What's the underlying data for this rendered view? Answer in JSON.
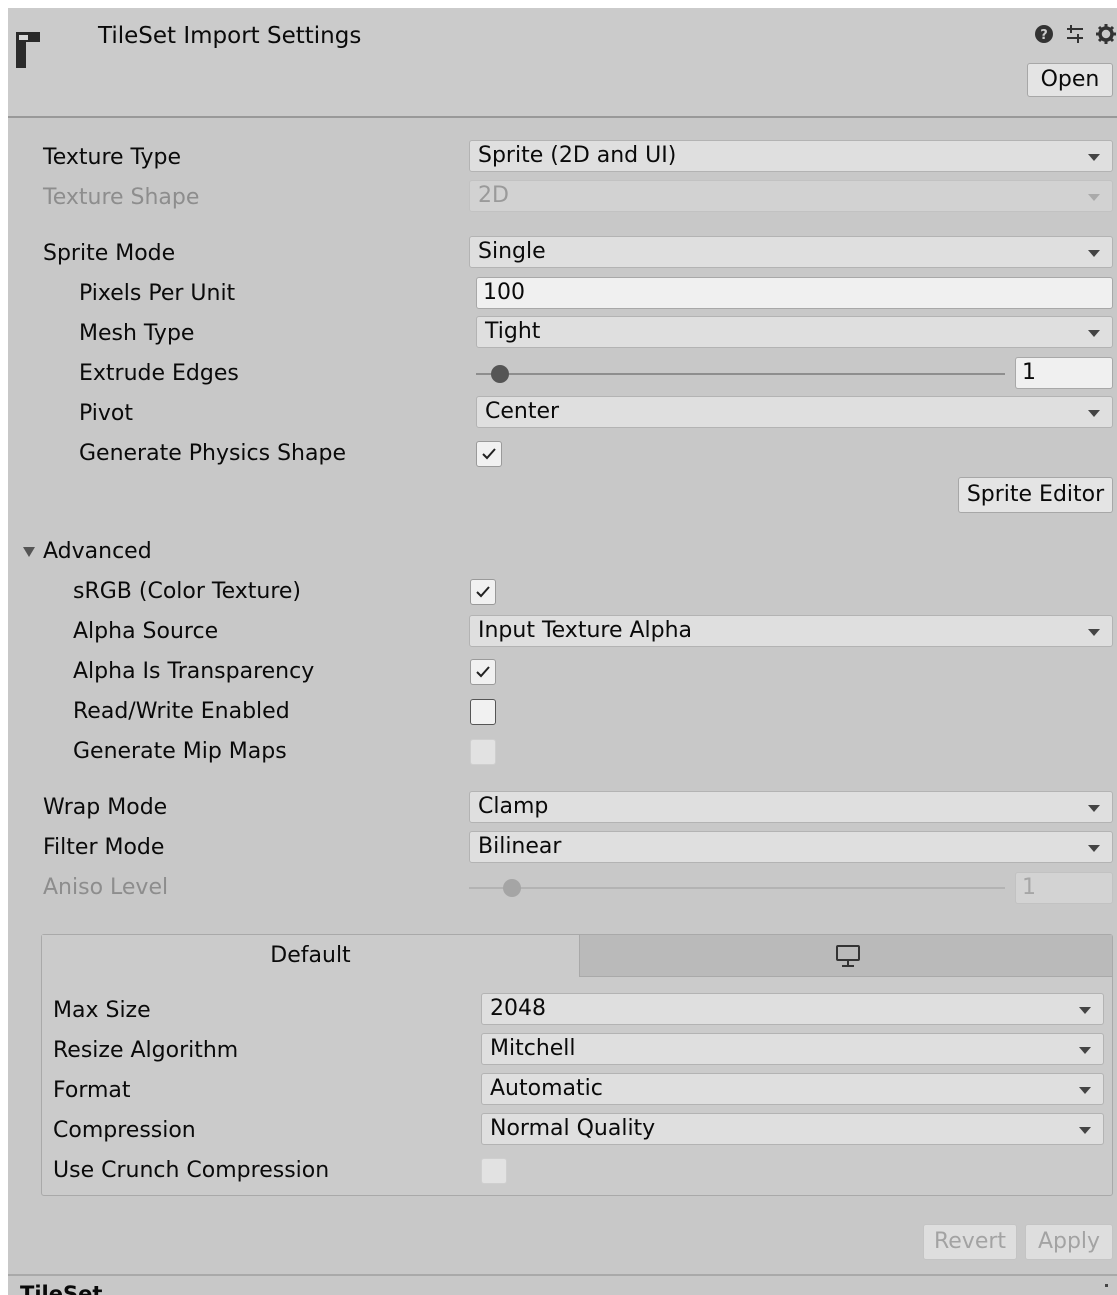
{
  "header": {
    "title": "TileSet Import Settings",
    "open_label": "Open",
    "icons": [
      "help-icon",
      "preset-icon",
      "settings-gear-icon"
    ]
  },
  "settings": {
    "texture_type": {
      "label": "Texture Type",
      "value": "Sprite (2D and UI)"
    },
    "texture_shape": {
      "label": "Texture Shape",
      "value": "2D"
    },
    "sprite_mode": {
      "label": "Sprite Mode",
      "value": "Single"
    },
    "pixels_per_unit": {
      "label": "Pixels Per Unit",
      "value": "100"
    },
    "mesh_type": {
      "label": "Mesh Type",
      "value": "Tight"
    },
    "extrude_edges": {
      "label": "Extrude Edges",
      "value": "1"
    },
    "pivot": {
      "label": "Pivot",
      "value": "Center"
    },
    "generate_physics_shape": {
      "label": "Generate Physics Shape",
      "checked": true
    },
    "sprite_editor_label": "Sprite Editor"
  },
  "advanced": {
    "title": "Advanced",
    "srgb": {
      "label": "sRGB (Color Texture)",
      "checked": true
    },
    "alpha_source": {
      "label": "Alpha Source",
      "value": "Input Texture Alpha"
    },
    "alpha_is_transparency": {
      "label": "Alpha Is Transparency",
      "checked": true
    },
    "read_write": {
      "label": "Read/Write Enabled",
      "checked": false
    },
    "generate_mip_maps": {
      "label": "Generate Mip Maps",
      "checked": false
    }
  },
  "sampling": {
    "wrap_mode": {
      "label": "Wrap Mode",
      "value": "Clamp"
    },
    "filter_mode": {
      "label": "Filter Mode",
      "value": "Bilinear"
    },
    "aniso_level": {
      "label": "Aniso Level",
      "value": "1"
    }
  },
  "platform": {
    "tabs": [
      {
        "label": "Default"
      },
      {
        "icon": "monitor-icon"
      }
    ],
    "max_size": {
      "label": "Max Size",
      "value": "2048"
    },
    "resize_algorithm": {
      "label": "Resize Algorithm",
      "value": "Mitchell"
    },
    "format": {
      "label": "Format",
      "value": "Automatic"
    },
    "compression": {
      "label": "Compression",
      "value": "Normal Quality"
    },
    "use_crunch": {
      "label": "Use Crunch Compression",
      "checked": false
    }
  },
  "footer": {
    "revert_label": "Revert",
    "apply_label": "Apply",
    "next_section_label": "TileSet"
  }
}
